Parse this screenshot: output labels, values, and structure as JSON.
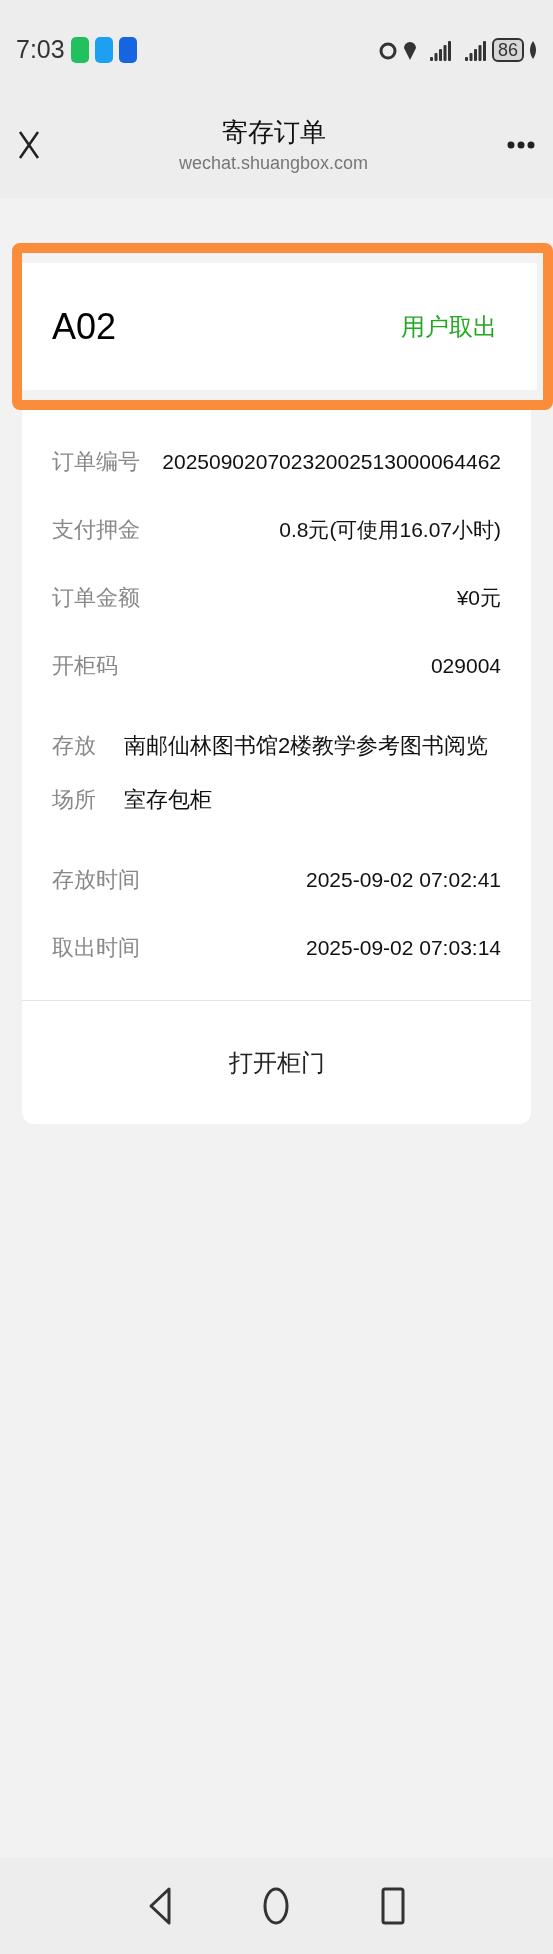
{
  "status_bar": {
    "time": "7:03",
    "battery": "86"
  },
  "header": {
    "title": "寄存订单",
    "subtitle": "wechat.shuangbox.com"
  },
  "locker": {
    "code": "A02",
    "status": "用户取出"
  },
  "details": [
    {
      "label": "订单编号",
      "value": "20250902070232002513000064462"
    },
    {
      "label": "支付押金",
      "value": "0.8元(可使用16.07小时)"
    },
    {
      "label": "订单金额",
      "value": "¥0元"
    },
    {
      "label": "开柜码",
      "value": "029004"
    },
    {
      "label": "存放场所",
      "value": "南邮仙林图书馆2楼教学参考图书阅览室存包柜",
      "kind": "wrap"
    },
    {
      "label": "存放时间",
      "value": "2025-09-02 07:02:41"
    },
    {
      "label": "取出时间",
      "value": "2025-09-02 07:03:14"
    }
  ],
  "action": {
    "label": "打开柜门"
  }
}
